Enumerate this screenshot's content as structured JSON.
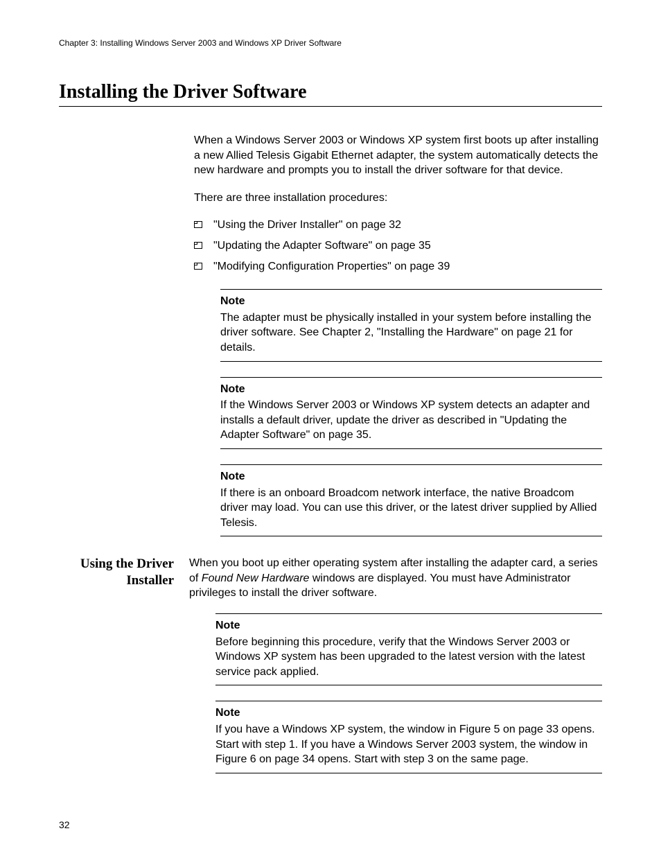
{
  "header": "Chapter 3: Installing Windows Server 2003 and Windows XP Driver Software",
  "title": "Installing the Driver Software",
  "intro_p1": "When a Windows Server 2003 or Windows XP system first boots up after installing a new Allied Telesis Gigabit Ethernet adapter, the system automatically detects the new hardware and prompts you to install the driver software for that device.",
  "intro_p2": "There are three installation procedures:",
  "bullets": [
    "\"Using the Driver Installer\" on page 32",
    "\"Updating the Adapter Software\" on page 35",
    "\"Modifying Configuration Properties\" on page 39"
  ],
  "noteLabel": "Note",
  "notes_top": [
    "The adapter must be physically installed in your system before installing the driver software. See Chapter 2, \"Installing the Hardware\" on page 21 for details.",
    "If the Windows Server 2003 or Windows XP system detects an adapter and installs a default driver, update the driver as described in \"Updating the Adapter Software\" on page 35.",
    "If there is an onboard Broadcom network interface, the native Broadcom driver may load. You can use this driver, or the latest driver supplied by Allied Telesis."
  ],
  "sub": {
    "heading": "Using the Driver Installer",
    "para_pre": "When you boot up either operating system after installing the adapter card, a series of ",
    "para_italic": "Found New Hardware",
    "para_post": " windows are displayed. You must have Administrator privileges to install the driver software.",
    "notes": [
      "Before beginning this procedure, verify that the Windows Server 2003 or Windows XP system has been upgraded to the latest version with the latest service pack applied.",
      "If you have a Windows XP system, the window in Figure 5 on page 33 opens. Start with step 1. If you have a Windows Server 2003 system, the window in Figure 6 on page 34 opens. Start with step 3 on the same page."
    ]
  },
  "page_number": "32"
}
